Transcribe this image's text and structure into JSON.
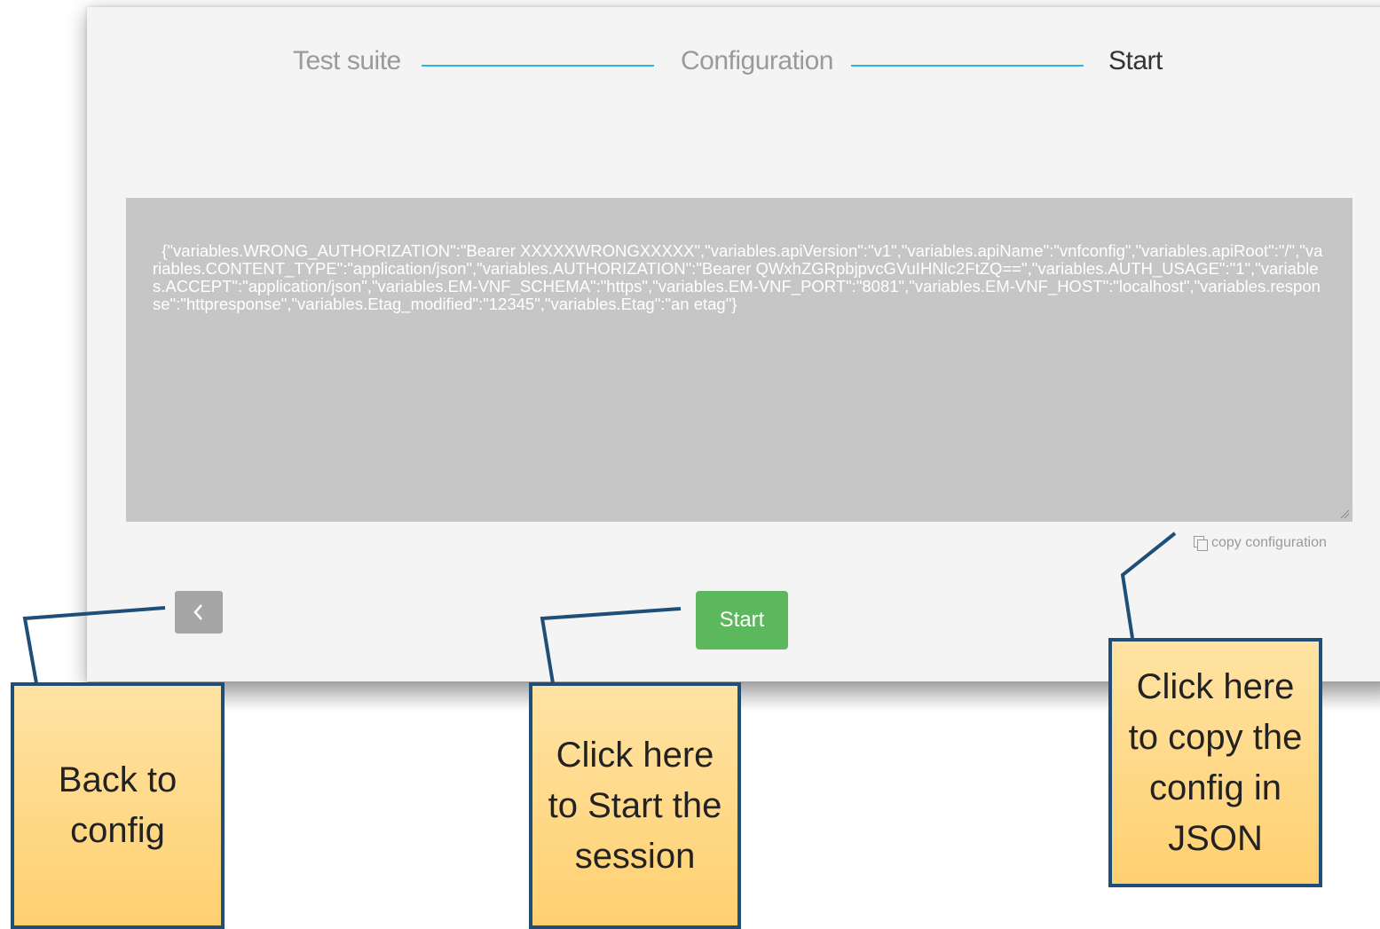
{
  "stepper": {
    "steps": [
      "Test suite",
      "Configuration",
      "Start"
    ],
    "active_step": "Start",
    "line_color": "#29b6e6"
  },
  "config": {
    "json_text": "{\"variables.WRONG_AUTHORIZATION\":\"Bearer XXXXXWRONGXXXXX\",\"variables.apiVersion\":\"v1\",\"variables.apiName\":\"vnfconfig\",\"variables.apiRoot\":\"/\",\"variables.CONTENT_TYPE\":\"application/json\",\"variables.AUTHORIZATION\":\"Bearer QWxhZGRpbjpvcGVuIHNlc2FtZQ==\",\"variables.AUTH_USAGE\":\"1\",\"variables.ACCEPT\":\"application/json\",\"variables.EM-VNF_SCHEMA\":\"https\",\"variables.EM-VNF_PORT\":\"8081\",\"variables.EM-VNF_HOST\":\"localhost\",\"variables.response\":\"httpresponse\",\"variables.Etag_modified\":\"12345\",\"variables.Etag\":\"an etag\"}",
    "copy_label": "copy configuration"
  },
  "buttons": {
    "back_icon": "chevron-left-icon",
    "start_label": "Start",
    "start_color": "#5cb85c"
  },
  "callouts": {
    "back": "Back to config",
    "start": "Click here to Start the session",
    "copy": "Click here to copy the config in JSON"
  }
}
